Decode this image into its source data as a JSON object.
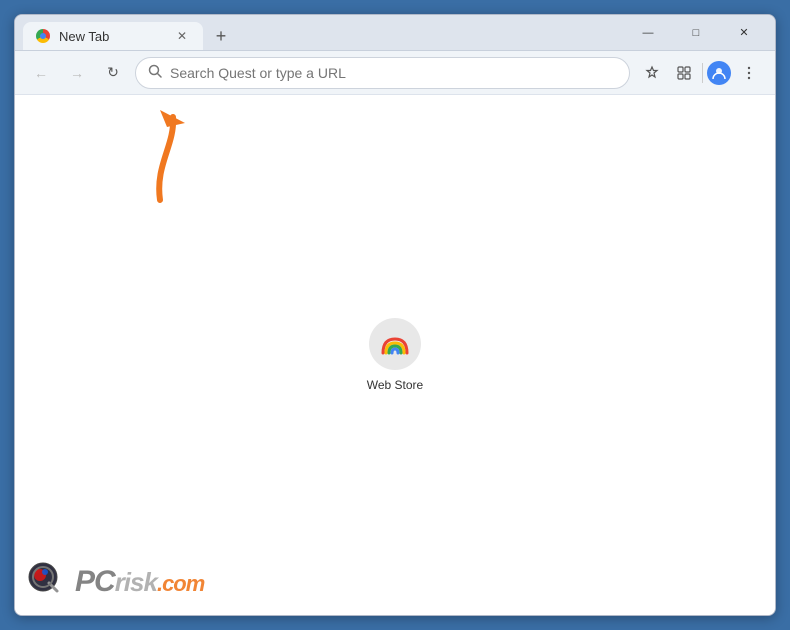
{
  "browser": {
    "tab": {
      "title": "New Tab",
      "active": true
    },
    "controls": {
      "minimize": "—",
      "maximize": "□",
      "close": "✕"
    },
    "nav": {
      "back_label": "←",
      "forward_label": "→",
      "refresh_label": "↻",
      "address_placeholder": "Search Quest or type a URL"
    },
    "new_tab_btn": "+"
  },
  "content": {
    "shortcut": {
      "label": "Web Store",
      "icon_alt": "webstore-icon"
    }
  },
  "annotation": {
    "arrow_color": "#f07820"
  },
  "watermark": {
    "pc": "PC",
    "risk": "risk",
    "com": ".com"
  }
}
